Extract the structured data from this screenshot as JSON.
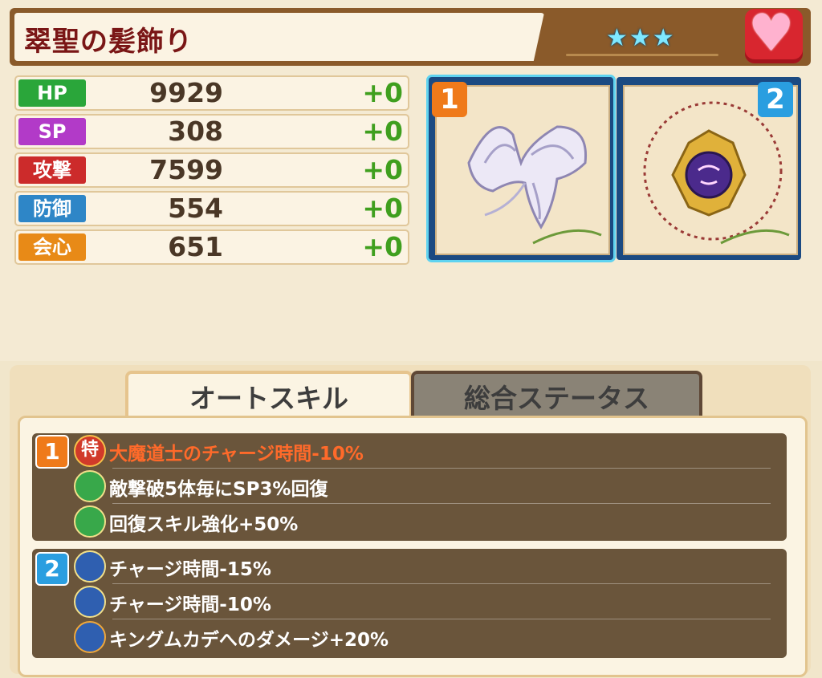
{
  "item": {
    "name": "翠聖の髪飾り",
    "stars": "★★★"
  },
  "stats": [
    {
      "label": "HP",
      "value": "9929",
      "bonus": "+0",
      "color": "#2aa63a"
    },
    {
      "label": "SP",
      "value": "308",
      "bonus": "+0",
      "color": "#b23ac8"
    },
    {
      "label": "攻撃",
      "value": "7599",
      "bonus": "+0",
      "color": "#cc2b2b"
    },
    {
      "label": "防御",
      "value": "554",
      "bonus": "+0",
      "color": "#2e86c7"
    },
    {
      "label": "会心",
      "value": "651",
      "bonus": "+0",
      "color": "#e88a17"
    }
  ],
  "slots": [
    {
      "number": "1",
      "item_icon": "butterfly-hair-ornament-icon"
    },
    {
      "number": "2",
      "item_icon": "demon-amulet-icon"
    }
  ],
  "tabs": {
    "auto_skill": "オートスキル",
    "total_status": "総合ステータス"
  },
  "skills": {
    "group1": {
      "number": "1",
      "lines": [
        {
          "icon": "special-icon",
          "text": "大魔道士のチャージ時間-10%"
        },
        {
          "icon": "heal-shield-icon",
          "text": "敵撃破5体毎にSP3%回復"
        },
        {
          "icon": "heal-shield-icon",
          "text": "回復スキル強化+50%"
        }
      ]
    },
    "group2": {
      "number": "2",
      "lines": [
        {
          "icon": "clock-icon",
          "text": "チャージ時間-15%"
        },
        {
          "icon": "clock-icon",
          "text": "チャージ時間-10%"
        },
        {
          "icon": "monster-slayer-icon",
          "text": "キングムカデへのダメージ+20%"
        }
      ]
    }
  },
  "colors": {
    "highlight_text": "#ff6a2a",
    "bonus_green": "#3f9f1e",
    "slot_frame": "#1b4a82"
  }
}
